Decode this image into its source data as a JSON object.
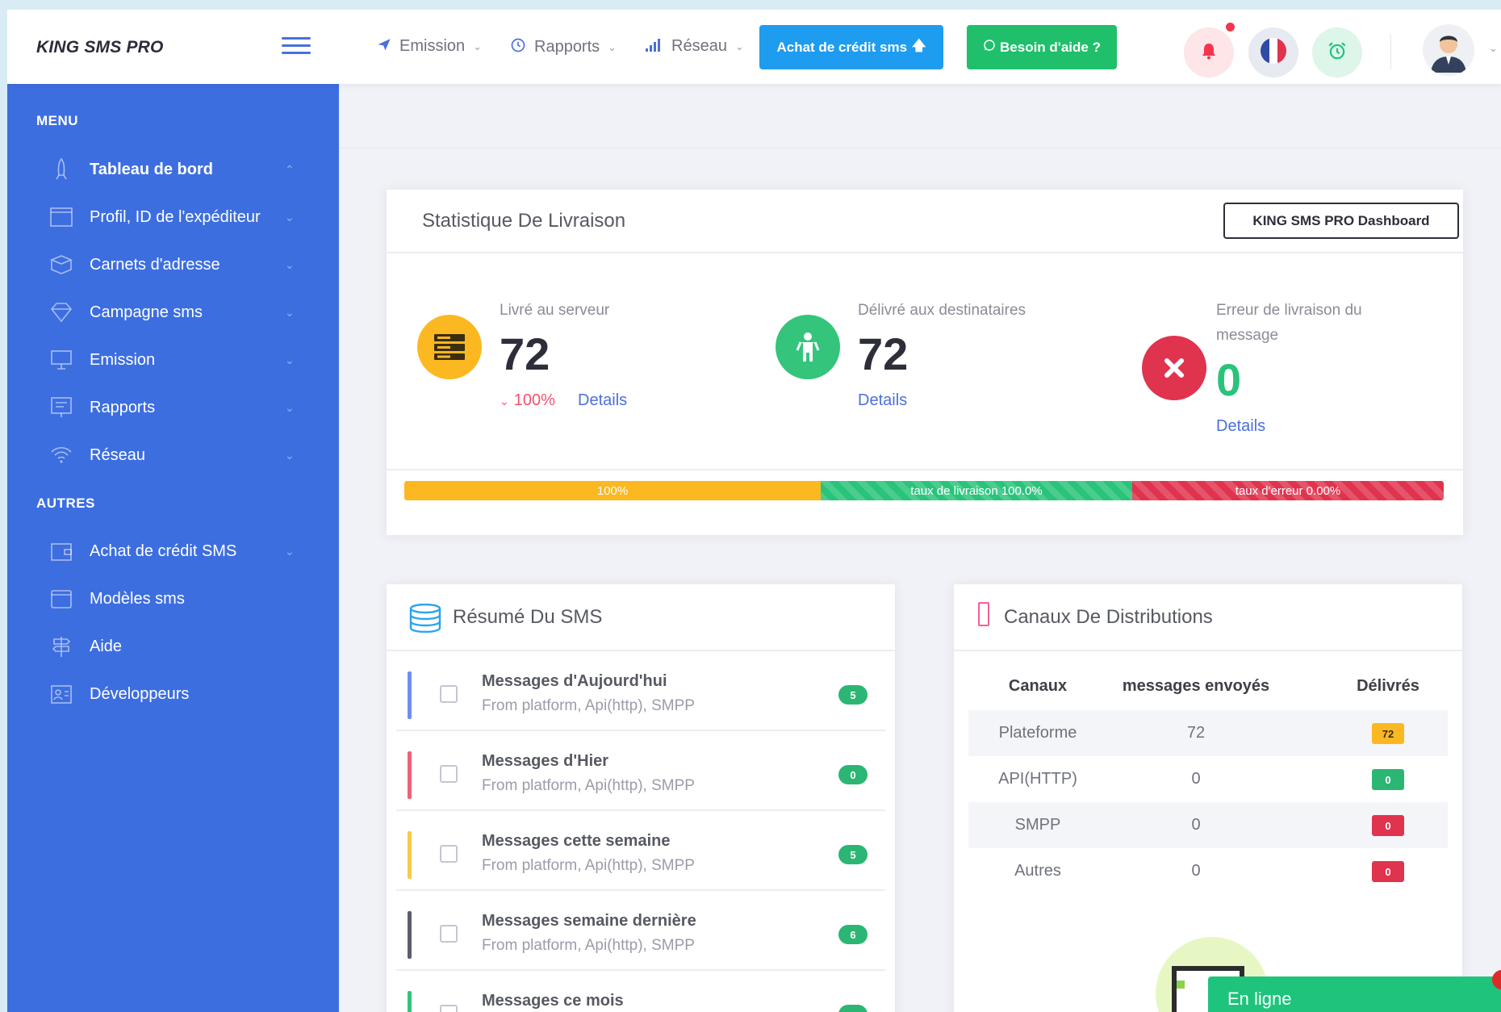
{
  "app": {
    "brand": "KING SMS PRO"
  },
  "topnav": {
    "emission": "Emission",
    "rapports": "Rapports",
    "reseau": "Réseau",
    "buy_credit": "Achat de crédit sms",
    "help": "Besoin d'aide ?"
  },
  "sidebar": {
    "menu_title": "MENU",
    "others_title": "AUTRES",
    "menu_items": [
      {
        "label": "Tableau de bord",
        "icon": "rocket-icon"
      },
      {
        "label": "Profil, ID de l'expéditeur",
        "icon": "browser-icon"
      },
      {
        "label": "Carnets d'adresse",
        "icon": "box-icon"
      },
      {
        "label": "Campagne sms",
        "icon": "diamond-icon"
      },
      {
        "label": "Emission",
        "icon": "monitor-icon"
      },
      {
        "label": "Rapports",
        "icon": "board-icon"
      },
      {
        "label": "Réseau",
        "icon": "wifi-icon"
      }
    ],
    "other_items": [
      {
        "label": "Achat de crédit SMS",
        "icon": "wallet-icon"
      },
      {
        "label": "Modèles sms",
        "icon": "window-icon"
      },
      {
        "label": "Aide",
        "icon": "signpost-icon"
      },
      {
        "label": "Développeurs",
        "icon": "id-card-icon"
      }
    ]
  },
  "stats": {
    "title": "Statistique De Livraison",
    "dashboard_button": "KING SMS PRO Dashboard",
    "server": {
      "label": "Livré au serveur",
      "value": "72",
      "pct": "100%",
      "link": "Details"
    },
    "delivered": {
      "label": "Délivré aux destinataires",
      "value": "72",
      "link": "Details"
    },
    "error": {
      "label_line1": "Erreur de livraison du",
      "label_line2": "message",
      "value": "0",
      "link": "Details"
    },
    "progress": {
      "seg1": "100%",
      "seg2": "taux de livraison 100.0%",
      "seg3": "taux d'erreur 0.00%"
    }
  },
  "summary": {
    "title": "Résumé Du SMS",
    "rows": [
      {
        "title": "Messages d'Aujourd'hui",
        "sub": "From platform, Api(http), SMPP",
        "count": "5"
      },
      {
        "title": "Messages d'Hier",
        "sub": "From platform, Api(http), SMPP",
        "count": "0"
      },
      {
        "title": "Messages cette semaine",
        "sub": "From platform, Api(http), SMPP",
        "count": "5"
      },
      {
        "title": "Messages semaine dernière",
        "sub": "From platform, Api(http), SMPP",
        "count": "6"
      },
      {
        "title": "Messages ce mois",
        "sub": "",
        "count": ""
      }
    ]
  },
  "channels": {
    "title": "Canaux De Distributions",
    "headers": [
      "Canaux",
      "messages envoyés",
      "Délivrés"
    ],
    "rows": [
      {
        "name": "Plateforme",
        "sent": "72",
        "delivered": "72"
      },
      {
        "name": "API(HTTP)",
        "sent": "0",
        "delivered": "0"
      },
      {
        "name": "SMPP",
        "sent": "0",
        "delivered": "0"
      },
      {
        "name": "Autres",
        "sent": "0",
        "delivered": "0"
      }
    ]
  },
  "chat": {
    "label": "En ligne"
  },
  "colors": {
    "sidebar": "#3d6ee0",
    "accent": "#4b6fdc",
    "success": "#29c37a",
    "danger": "#e0334e",
    "warning": "#fbb821"
  }
}
